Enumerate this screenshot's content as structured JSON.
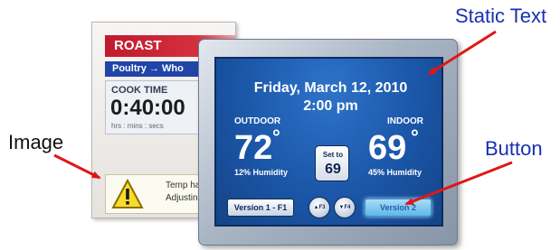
{
  "annotations": {
    "static_text": "Static Text",
    "image": "Image",
    "button": "Button"
  },
  "oven_panel": {
    "title": "ROAST",
    "subtitle": "Poultry → Who",
    "cook_time_label": "COOK TIME",
    "cook_time_value": "0:40:00",
    "cook_time_units": "hrs : mins : secs",
    "warning_line_1": "Temp has",
    "warning_line_2": "Adjusting",
    "warning_icon": "warning-triangle-icon"
  },
  "thermostat": {
    "date": "Friday, March 12, 2010",
    "time": "2:00 pm",
    "outdoor_label": "OUTDOOR",
    "indoor_label": "INDOOR",
    "outdoor_temp": "72",
    "indoor_temp": "69",
    "degree_symbol": "°",
    "outdoor_humidity": "12% Humidity",
    "indoor_humidity": "45% Humidity",
    "set_to_label": "Set to",
    "set_to_value": "69",
    "version1_label": "Version 1 - F1",
    "version2_label": "Version 2",
    "up_button_label": "▲F3",
    "down_button_label": "▼F4"
  },
  "colors": {
    "callout_blue": "#1a2fb3",
    "arrow_red": "#e01616",
    "screen_blue": "#1b56a8",
    "roast_red": "#c01a2c"
  }
}
